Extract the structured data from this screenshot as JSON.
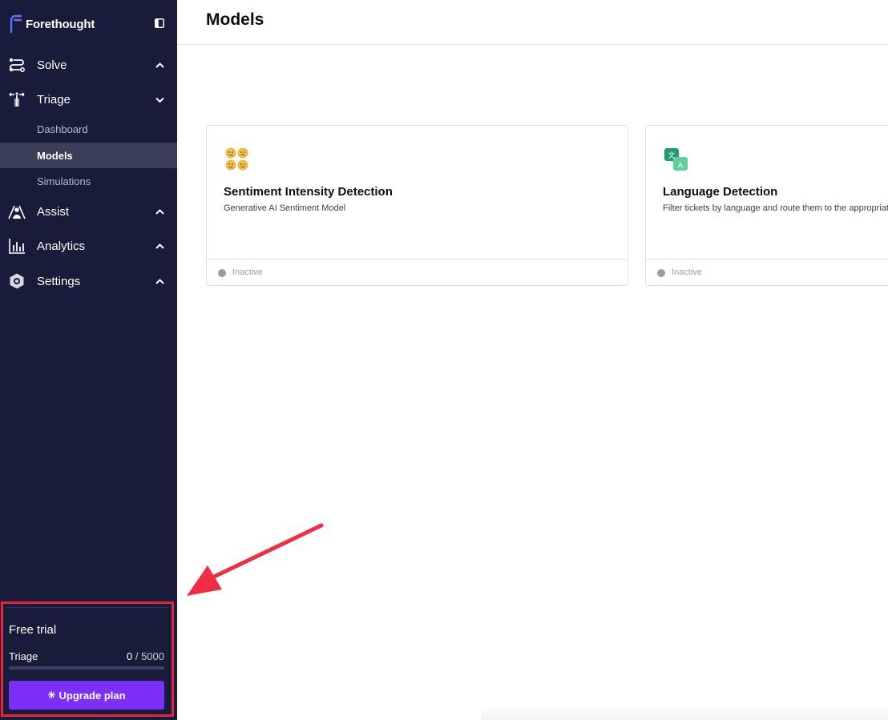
{
  "brand": {
    "name": "Forethought"
  },
  "sidebar": {
    "nav": [
      {
        "label": "Solve",
        "icon": "solve-icon",
        "chevron": "up"
      },
      {
        "label": "Triage",
        "icon": "triage-icon",
        "chevron": "down"
      },
      {
        "label": "Assist",
        "icon": "assist-icon",
        "chevron": "up"
      },
      {
        "label": "Analytics",
        "icon": "analytics-icon",
        "chevron": "up"
      },
      {
        "label": "Settings",
        "icon": "settings-icon",
        "chevron": "up"
      }
    ],
    "triage_sub": [
      {
        "label": "Dashboard",
        "active": false
      },
      {
        "label": "Models",
        "active": true
      },
      {
        "label": "Simulations",
        "active": false
      }
    ]
  },
  "trial": {
    "title": "Free trial",
    "product": "Triage",
    "used": "0",
    "separator": "/",
    "limit": "5000",
    "progress_fraction": 0,
    "upgrade_label": "Upgrade plan"
  },
  "header": {
    "title": "Models"
  },
  "cards": [
    {
      "title": "Sentiment Intensity Detection",
      "description": "Generative AI Sentiment Model",
      "status": "Inactive",
      "icon": "sentiment-faces-icon"
    },
    {
      "title": "Language Detection",
      "description": "Filter tickets by language and route them to the appropriate",
      "status": "Inactive",
      "icon": "translate-icon"
    }
  ],
  "colors": {
    "sidebar_bg": "#181c3a",
    "active_bg": "#3a3e58",
    "accent": "#7b2ff7",
    "highlight": "#e8243a",
    "inactive": "#9a9ca6"
  }
}
